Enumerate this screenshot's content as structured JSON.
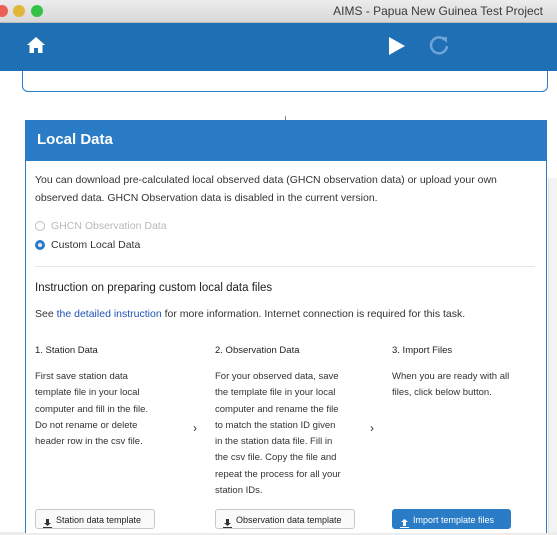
{
  "window": {
    "title": "AIMS - Papua New Guinea Test Project",
    "lights": [
      "#ec5f57",
      "#e2b63a",
      "#35c048"
    ]
  },
  "toolbar": {
    "icons": [
      "home-icon",
      "play-icon",
      "refresh-icon"
    ],
    "accent": "#1f6fb5"
  },
  "flow": {
    "arrow": "↓"
  },
  "panel": {
    "title": "Local Data",
    "description_line1": "You can download pre-calculated local observed data (GHCN observation data) or upload your own",
    "description_line2": "observed data. GHCN Observation data is disabled in the current version.",
    "options": [
      {
        "label": "GHCN Observation Data",
        "selected": false,
        "disabled": true
      },
      {
        "label": "Custom Local Data",
        "selected": true,
        "disabled": false
      }
    ],
    "instruction_title": "Instruction on preparing custom local data files",
    "see_prefix": "See ",
    "see_link": "the detailed instruction",
    "see_suffix": " for more information. Internet connection is required for this task.",
    "steps": [
      {
        "title": "1. Station Data",
        "lines": [
          "First save station data",
          "template file in your local",
          "computer and fill in the file.",
          "Do not rename or delete",
          "header row in the csv file."
        ],
        "button": "Station data template"
      },
      {
        "title": "2. Observation Data",
        "lines": [
          "For your observed data, save",
          "the template file in your local",
          "computer and rename the file",
          "to match the station ID given",
          "in the station data file. Fill in",
          "the csv file. Copy the file and",
          "repeat the process for all your",
          "station IDs."
        ],
        "button": "Observation data template"
      },
      {
        "title": "3. Import Files",
        "lines": [
          "When you are ready with all",
          "files, click below button."
        ],
        "button": "Import template files"
      }
    ],
    "chevron": "›",
    "accent": "#2a7cc7"
  }
}
